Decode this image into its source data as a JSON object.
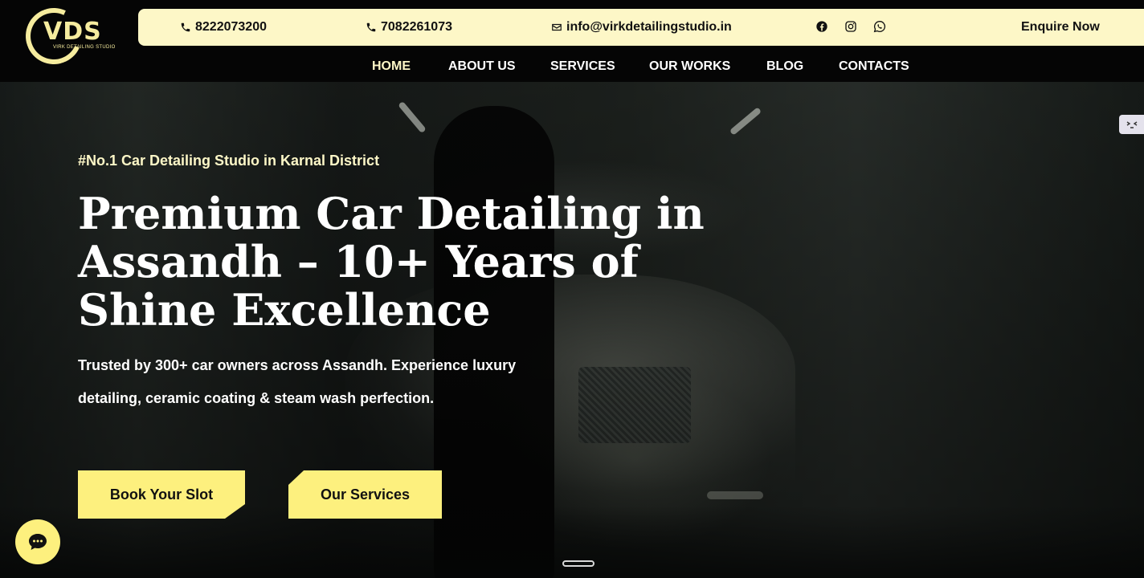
{
  "logo": {
    "mark": "VDS",
    "subtitle": "VIRK DETAILING STUDIO"
  },
  "topbar": {
    "phone1": "8222073200",
    "phone2": "7082261073",
    "email": "info@virkdetailingstudio.in",
    "social": [
      "facebook-icon",
      "instagram-icon",
      "whatsapp-icon"
    ],
    "enquire": "Enquire Now"
  },
  "nav": {
    "items": [
      "HOME",
      "ABOUT US",
      "SERVICES",
      "OUR WORKS",
      "BLOG",
      "CONTACTS"
    ],
    "active": "HOME"
  },
  "hero": {
    "tagline": "#No.1 Car Detailing Studio in Karnal District",
    "headline": "Premium Car Detailing in Assandh – 10+ Years of Shine Excellence",
    "lead": "Trusted by 300+ car owners across Assandh. Experience luxury detailing, ceramic coating & steam wash perfection.",
    "buttons": {
      "book": "Book Your Slot",
      "services": "Our Services"
    }
  },
  "colors": {
    "accent": "#fdf7c7",
    "button": "#fdf07e",
    "header": "#050505"
  }
}
